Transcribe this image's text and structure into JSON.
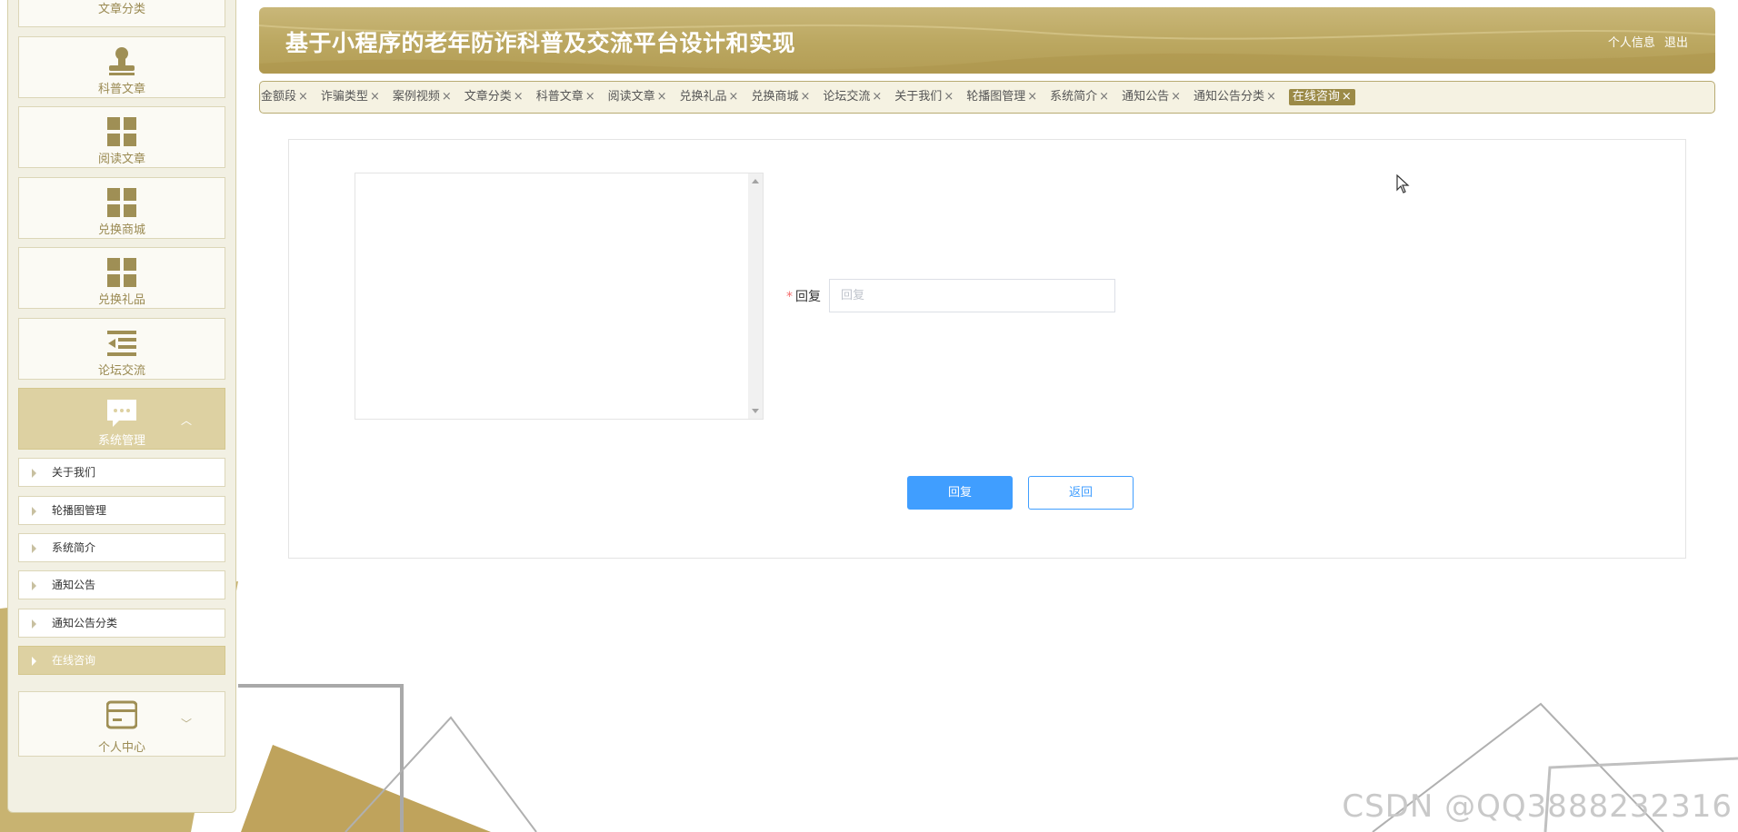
{
  "header": {
    "title": "基于小程序的老年防诈科普及交流平台设计和实现",
    "links": [
      "个人信息",
      "退出"
    ]
  },
  "sidebar": {
    "top_partial_label": "文章分类",
    "cards": [
      {
        "label": "科普文章",
        "icon": "stamp-icon"
      },
      {
        "label": "阅读文章",
        "icon": "grid-icon"
      },
      {
        "label": "兑换商城",
        "icon": "grid-icon"
      },
      {
        "label": "兑换礼品",
        "icon": "grid-icon"
      },
      {
        "label": "论坛交流",
        "icon": "list-indent-icon"
      },
      {
        "label": "系统管理",
        "icon": "chat-bubble-icon",
        "expanded": true
      },
      {
        "label": "个人中心",
        "icon": "card-icon",
        "expanded": false
      }
    ],
    "sub_items": [
      "关于我们",
      "轮播图管理",
      "系统简介",
      "通知公告",
      "通知公告分类",
      "在线咨询"
    ],
    "active_sub_item": "在线咨询"
  },
  "tabs": {
    "items": [
      "骗金额段",
      "诈骗类型",
      "案例视频",
      "文章分类",
      "科普文章",
      "阅读文章",
      "兑换礼品",
      "兑换商城",
      "论坛交流",
      "关于我们",
      "轮播图管理",
      "系统简介",
      "通知公告",
      "通知公告分类",
      "在线咨询"
    ],
    "active": "在线咨询",
    "close_glyph": "×"
  },
  "form": {
    "reply_label": "回复",
    "required_mark": "*",
    "reply_placeholder": "回复",
    "reply_value": "",
    "submit_label": "回复",
    "back_label": "返回"
  },
  "watermark": "CSDN @QQ3888232316",
  "colors": {
    "brand": "#bba760",
    "tab_active": "#9b8a47",
    "primary_button": "#409eff",
    "sidebar_bg": "#f2f0e3",
    "sidebar_active": "#ddd1a2"
  }
}
